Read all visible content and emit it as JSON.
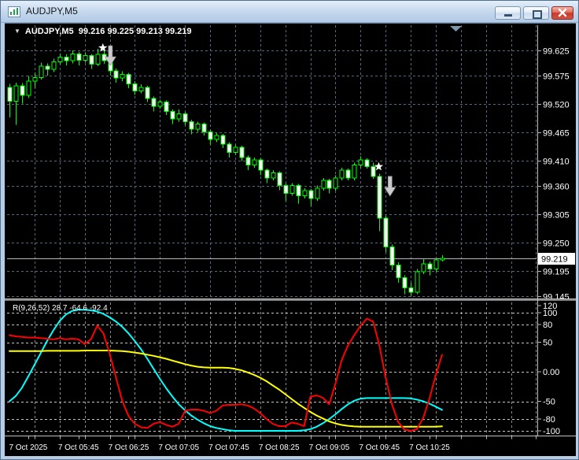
{
  "window": {
    "title": "AUDJPY,M5"
  },
  "chart": {
    "header_text": "AUDJPY,M5  99.216 99.225 99.213 99.219",
    "indicator_label": "R(9,26,52) 28.7 -64.6 -92.4"
  },
  "icons": {
    "dropdown": "triangle-down-icon",
    "minimize": "minimize-icon",
    "restore": "restore-icon",
    "close": "close-icon",
    "signal": "arrow-down-icon",
    "star": "star-icon"
  },
  "colors": {
    "background": "#000000",
    "candle_outline": "#00ff00",
    "bull_fill": "#000000",
    "bear_fill": "#ffffff",
    "main_grid": "#546a7e",
    "sub_grid": "#8a8a8a",
    "sub_levels": "#c8c8c8",
    "current_price_line": "#b8b8b8",
    "axis_text": "#ffffff",
    "arrow": "#cbcbcb",
    "star": "#ffffff",
    "indicator_red": "#ff0000",
    "indicator_cyan": "#00ffff",
    "indicator_yellow": "#ffff00"
  },
  "chart_data": {
    "type": "candlestick",
    "symbol": "AUDJPY",
    "timeframe": "M5",
    "title": "AUDJPY,M5",
    "ohlc_header": {
      "open": "99.216",
      "high": "99.225",
      "low": "99.213",
      "close": "99.219"
    },
    "current_price": 99.219,
    "current_label": "99.219",
    "ylim": [
      99.125,
      99.673
    ],
    "grid": "dashed",
    "y_axis": {
      "labels": [
        "99.625",
        "99.575",
        "99.520",
        "99.465",
        "99.410",
        "99.360",
        "99.305",
        "99.250",
        "99.195",
        "99.145"
      ],
      "values": [
        99.625,
        99.575,
        99.52,
        99.465,
        99.41,
        99.36,
        99.305,
        99.25,
        99.195,
        99.145
      ]
    },
    "x_axis": {
      "labels": [
        {
          "text": "7 Oct 2025",
          "index": 3
        },
        {
          "text": "7 Oct 05:45",
          "index": 11
        },
        {
          "text": "7 Oct 06:25",
          "index": 19
        },
        {
          "text": "7 Oct 07:05",
          "index": 27
        },
        {
          "text": "7 Oct 07:45",
          "index": 35
        },
        {
          "text": "7 Oct 08:25",
          "index": 43
        },
        {
          "text": "7 Oct 09:05",
          "index": 51
        },
        {
          "text": "7 Oct 09:45",
          "index": 59
        },
        {
          "text": "7 Oct 10:25",
          "index": 67
        }
      ]
    },
    "candles": [
      [
        99.553,
        99.56,
        99.494,
        99.526
      ],
      [
        99.526,
        99.562,
        99.48,
        99.556
      ],
      [
        99.556,
        99.561,
        99.521,
        99.537
      ],
      [
        99.537,
        99.575,
        99.532,
        99.565
      ],
      [
        99.565,
        99.581,
        99.552,
        99.572
      ],
      [
        99.572,
        99.601,
        99.568,
        99.594
      ],
      [
        99.594,
        99.6,
        99.576,
        99.588
      ],
      [
        99.588,
        99.609,
        99.583,
        99.603
      ],
      [
        99.603,
        99.619,
        99.598,
        99.612
      ],
      [
        99.612,
        99.617,
        99.596,
        99.605
      ],
      [
        99.605,
        99.625,
        99.6,
        99.618
      ],
      [
        99.618,
        99.622,
        99.596,
        99.606
      ],
      [
        99.606,
        99.621,
        99.601,
        99.615
      ],
      [
        99.615,
        99.618,
        99.589,
        99.598
      ],
      [
        99.598,
        99.628,
        99.594,
        99.617
      ],
      [
        99.617,
        99.624,
        99.599,
        99.605
      ],
      [
        99.605,
        99.615,
        99.576,
        99.585
      ],
      [
        99.585,
        99.59,
        99.562,
        99.571
      ],
      [
        99.571,
        99.584,
        99.565,
        99.578
      ],
      [
        99.578,
        99.581,
        99.551,
        99.56
      ],
      [
        99.56,
        99.565,
        99.538,
        99.546
      ],
      [
        99.546,
        99.559,
        99.541,
        99.553
      ],
      [
        99.553,
        99.556,
        99.524,
        99.531
      ],
      [
        99.531,
        99.535,
        99.506,
        99.516
      ],
      [
        99.516,
        99.529,
        99.511,
        99.524
      ],
      [
        99.524,
        99.527,
        99.499,
        99.506
      ],
      [
        99.506,
        99.51,
        99.481,
        99.491
      ],
      [
        99.491,
        99.51,
        99.486,
        99.501
      ],
      [
        99.501,
        99.505,
        99.479,
        99.486
      ],
      [
        99.486,
        99.49,
        99.461,
        99.471
      ],
      [
        99.471,
        99.486,
        99.466,
        99.481
      ],
      [
        99.481,
        99.484,
        99.459,
        99.466
      ],
      [
        99.466,
        99.47,
        99.441,
        99.451
      ],
      [
        99.451,
        99.464,
        99.446,
        99.459
      ],
      [
        99.459,
        99.462,
        99.434,
        99.442
      ],
      [
        99.442,
        99.446,
        99.416,
        99.426
      ],
      [
        99.426,
        99.441,
        99.421,
        99.436
      ],
      [
        99.436,
        99.439,
        99.409,
        99.416
      ],
      [
        99.416,
        99.42,
        99.391,
        99.401
      ],
      [
        99.401,
        99.416,
        99.396,
        99.411
      ],
      [
        99.411,
        99.414,
        99.381,
        99.391
      ],
      [
        99.391,
        99.394,
        99.366,
        99.376
      ],
      [
        99.376,
        99.391,
        99.371,
        99.386
      ],
      [
        99.386,
        99.389,
        99.352,
        99.361
      ],
      [
        99.361,
        99.365,
        99.331,
        99.346
      ],
      [
        99.346,
        99.366,
        99.341,
        99.361
      ],
      [
        99.361,
        99.364,
        99.326,
        99.341
      ],
      [
        99.341,
        99.356,
        99.336,
        99.351
      ],
      [
        99.351,
        99.354,
        99.321,
        99.336
      ],
      [
        99.336,
        99.361,
        99.331,
        99.356
      ],
      [
        99.356,
        99.376,
        99.351,
        99.371
      ],
      [
        99.371,
        99.374,
        99.346,
        99.356
      ],
      [
        99.356,
        99.381,
        99.351,
        99.376
      ],
      [
        99.376,
        99.396,
        99.371,
        99.391
      ],
      [
        99.391,
        99.394,
        99.371,
        99.376
      ],
      [
        99.376,
        99.406,
        99.371,
        99.401
      ],
      [
        99.401,
        99.418,
        99.396,
        99.411
      ],
      [
        99.411,
        99.414,
        99.394,
        99.398
      ],
      [
        99.398,
        99.406,
        99.374,
        99.379
      ],
      [
        99.379,
        99.384,
        99.272,
        99.297
      ],
      [
        99.297,
        99.302,
        99.231,
        99.241
      ],
      [
        99.241,
        99.246,
        99.196,
        99.206
      ],
      [
        99.206,
        99.211,
        99.171,
        99.181
      ],
      [
        99.181,
        99.186,
        99.149,
        99.161
      ],
      [
        99.161,
        99.171,
        99.146,
        99.153
      ],
      [
        99.153,
        99.198,
        99.149,
        99.193
      ],
      [
        99.193,
        99.218,
        99.188,
        99.208
      ],
      [
        99.208,
        99.213,
        99.186,
        99.198
      ],
      [
        99.198,
        99.218,
        99.193,
        99.216
      ],
      [
        99.216,
        99.225,
        99.213,
        99.219
      ]
    ],
    "markers": [
      {
        "type": "star",
        "index": 14.9,
        "price": 99.63
      },
      {
        "type": "arrow-down",
        "index": 16.1,
        "price": 99.634
      },
      {
        "type": "star",
        "index": 58.9,
        "price": 99.398
      },
      {
        "type": "arrow-down",
        "index": 60.7,
        "price": 99.379
      }
    ],
    "indicator": {
      "name_label": "R(9,26,52)",
      "last_values": "28.7 -64.6 -92.4",
      "sub_ylim": [
        -108,
        122
      ],
      "levels": [
        100,
        80,
        50,
        0,
        -50,
        -80,
        -100
      ],
      "axis": {
        "labels": [
          "120",
          "100",
          "80",
          "50",
          "0.00",
          "-50",
          "-80",
          "-100"
        ],
        "values": [
          120,
          100,
          80,
          50,
          0,
          -50,
          -80,
          -100
        ]
      },
      "series": [
        {
          "name": "cyan",
          "color": "#00ffff",
          "values": [
            -50,
            -41,
            -27,
            -8,
            12,
            32,
            52,
            70,
            86,
            97,
            103,
            105,
            105,
            104,
            102,
            98,
            92,
            85,
            76,
            65,
            52,
            38,
            22,
            5,
            -12,
            -28,
            -42,
            -55,
            -65,
            -74,
            -81,
            -87,
            -92,
            -95,
            -97,
            -99,
            -100,
            -100,
            -100,
            -100,
            -100,
            -100,
            -100,
            -100,
            -100,
            -100,
            -100,
            -99,
            -97,
            -93,
            -87,
            -80,
            -72,
            -63,
            -55,
            -49,
            -45.5,
            -44.5,
            -44.5,
            -44.5,
            -44.5,
            -44.5,
            -44.5,
            -44.5,
            -45,
            -47,
            -50,
            -54,
            -59,
            -64.6
          ]
        },
        {
          "name": "yellow",
          "color": "#ffff00",
          "values": [
            35,
            35,
            35,
            35,
            35,
            35,
            35.5,
            35.5,
            35.5,
            35.5,
            35.5,
            35.5,
            36,
            36,
            36,
            36,
            36,
            35.5,
            35,
            34,
            32.5,
            31,
            29,
            27,
            24.5,
            22,
            19,
            16,
            13,
            10.5,
            8.5,
            7.5,
            7,
            7,
            7,
            6.5,
            5,
            2.5,
            -1,
            -5,
            -10,
            -16,
            -23,
            -30,
            -38,
            -46,
            -54,
            -61,
            -68,
            -74,
            -79,
            -84,
            -87.5,
            -90,
            -91.5,
            -92.5,
            -93,
            -93,
            -93,
            -93,
            -93,
            -93,
            -93,
            -93,
            -93,
            -93,
            -93,
            -93,
            -93,
            -92.4
          ]
        },
        {
          "name": "red",
          "color": "#ff0000",
          "values": [
            62,
            60,
            59,
            58,
            58,
            57,
            56,
            55,
            57,
            55,
            56,
            55,
            47,
            55,
            78,
            65,
            30,
            -10,
            -50,
            -75,
            -88,
            -94,
            -95,
            -88,
            -85,
            -90,
            -93,
            -88,
            -66,
            -64,
            -64,
            -66,
            -70,
            -66,
            -57,
            -56,
            -56,
            -55,
            -57,
            -62,
            -70,
            -80,
            -88,
            -92,
            -92,
            -86,
            -88,
            -92,
            -42,
            -40,
            -44,
            -55,
            -20,
            20,
            45,
            62,
            78,
            90,
            85,
            45,
            -10,
            -55,
            -85,
            -98,
            -100,
            -97,
            -78,
            -45,
            -5,
            28.7
          ]
        }
      ]
    }
  }
}
